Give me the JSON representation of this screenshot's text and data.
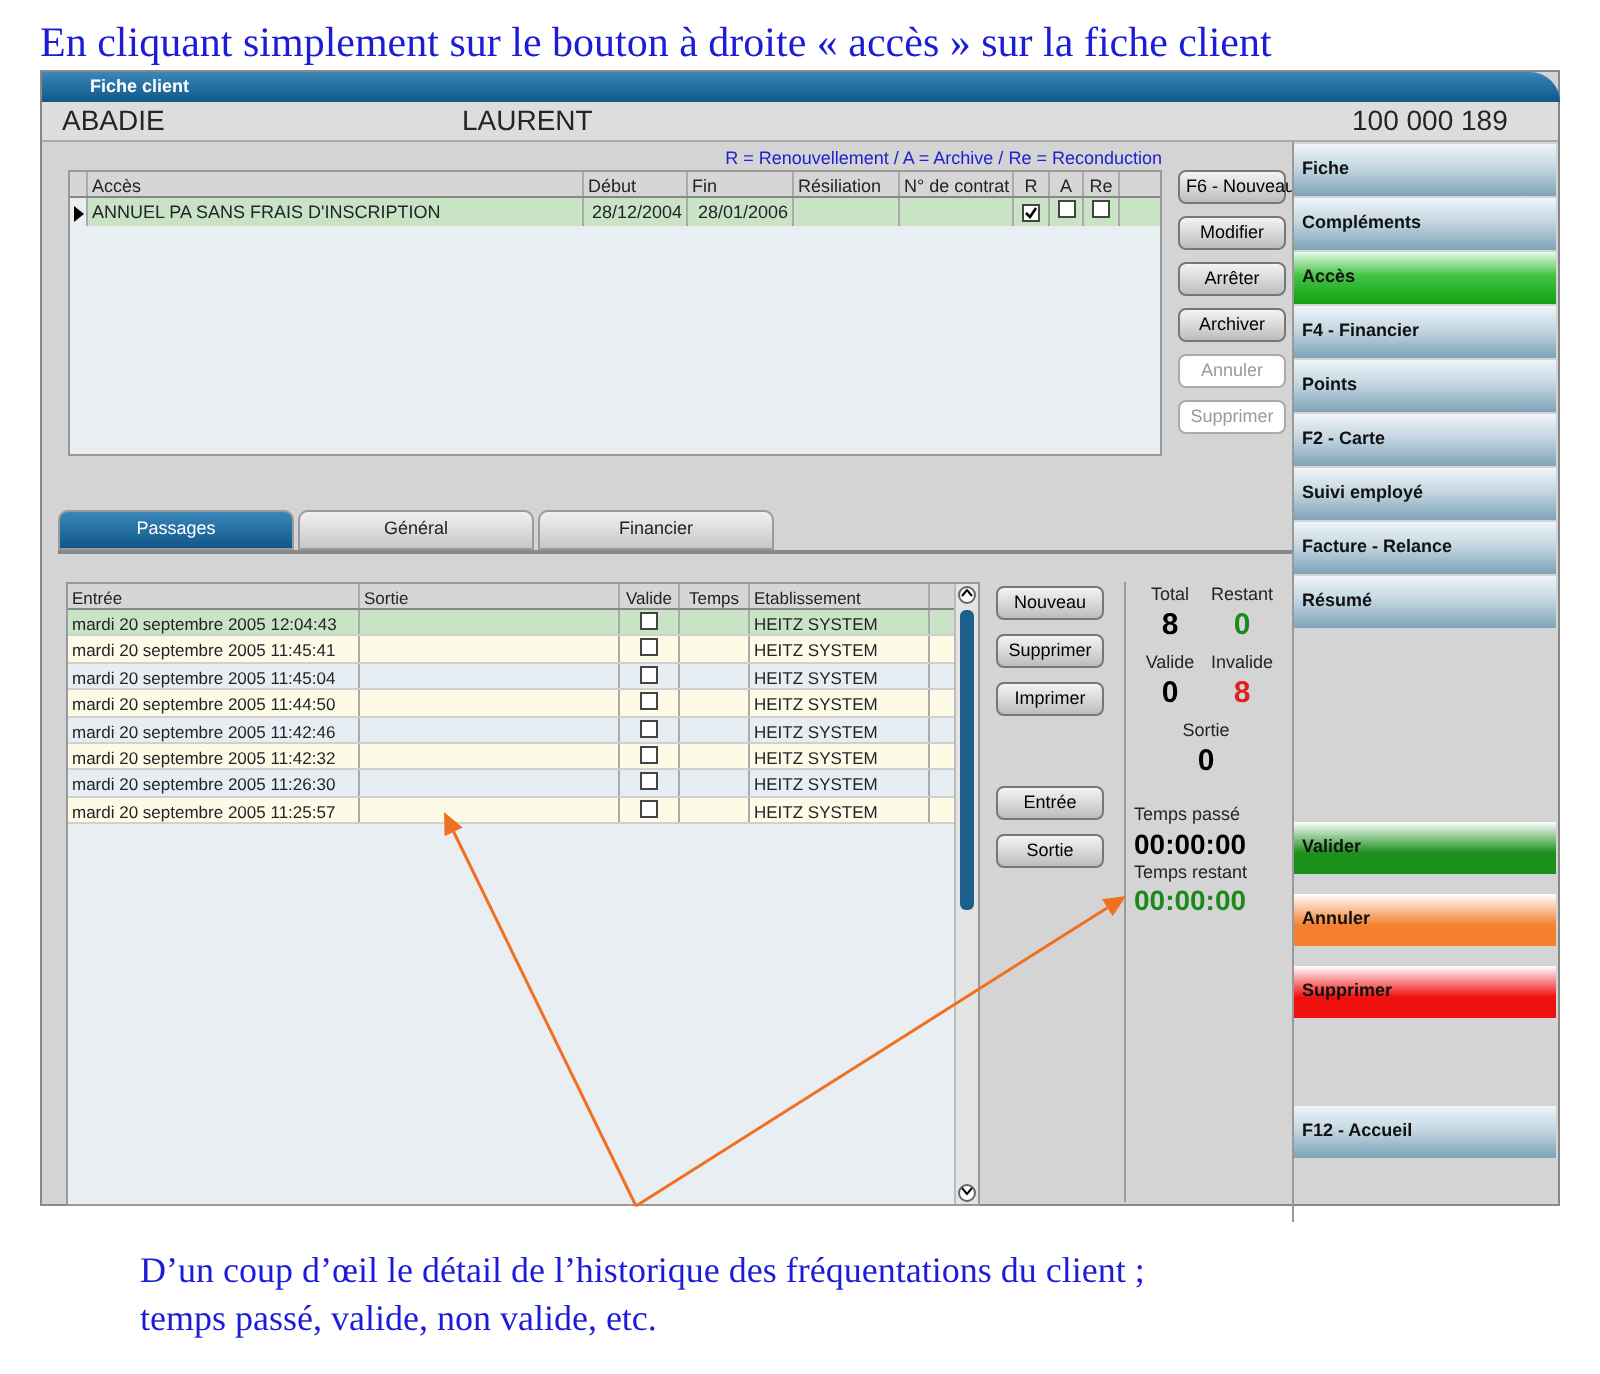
{
  "caption_top": "En cliquant simplement sur le bouton à droite « accès » sur la fiche client",
  "window": {
    "title": "Fiche client"
  },
  "client": {
    "last_name": "ABADIE",
    "first_name": "LAURENT",
    "number": "100 000 189"
  },
  "access": {
    "legend": "R = Renouvellement / A = Archive / Re = Reconduction",
    "columns": [
      "Accès",
      "Début",
      "Fin",
      "Résiliation",
      "N° de contrat",
      "R",
      "A",
      "Re"
    ],
    "rows": [
      {
        "current": true,
        "name": "ANNUEL PA SANS FRAIS D'INSCRIPTION",
        "start": "28/12/2004",
        "end": "28/01/2006",
        "r": true,
        "a": false,
        "re": false
      }
    ],
    "buttons": [
      {
        "label": "F6 - Nouveau",
        "disabled": false
      },
      {
        "label": "Modifier",
        "disabled": false
      },
      {
        "label": "Arrêter",
        "disabled": false
      },
      {
        "label": "Archiver",
        "disabled": false
      },
      {
        "label": "Annuler",
        "disabled": true
      },
      {
        "label": "Supprimer",
        "disabled": true
      }
    ]
  },
  "tabs": [
    {
      "label": "Passages",
      "selected": true
    },
    {
      "label": "Général",
      "selected": false
    },
    {
      "label": "Financier",
      "selected": false
    }
  ],
  "passages": {
    "columns": [
      "Entrée",
      "Sortie",
      "Valide",
      "Temps",
      "Etablissement"
    ],
    "rows": [
      {
        "entry": "mardi 20 septembre 2005 12:04:43",
        "valid": false,
        "site": "HEITZ SYSTEM",
        "selected": true
      },
      {
        "entry": "mardi 20 septembre 2005 11:45:41",
        "valid": false,
        "site": "HEITZ SYSTEM",
        "selected": false
      },
      {
        "entry": "mardi 20 septembre 2005 11:45:04",
        "valid": false,
        "site": "HEITZ SYSTEM",
        "selected": false
      },
      {
        "entry": "mardi 20 septembre 2005 11:44:50",
        "valid": false,
        "site": "HEITZ SYSTEM",
        "selected": false
      },
      {
        "entry": "mardi 20 septembre 2005 11:42:46",
        "valid": false,
        "site": "HEITZ SYSTEM",
        "selected": false
      },
      {
        "entry": "mardi 20 septembre 2005 11:42:32",
        "valid": false,
        "site": "HEITZ SYSTEM",
        "selected": false
      },
      {
        "entry": "mardi 20 septembre 2005 11:26:30",
        "valid": false,
        "site": "HEITZ SYSTEM",
        "selected": false
      },
      {
        "entry": "mardi 20 septembre 2005 11:25:57",
        "valid": false,
        "site": "HEITZ SYSTEM",
        "selected": false
      }
    ],
    "buttons_top": [
      "Nouveau",
      "Supprimer",
      "Imprimer"
    ],
    "buttons_bottom": [
      "Entrée",
      "Sortie"
    ]
  },
  "stats": {
    "counts": [
      {
        "label": "Total",
        "value": "8",
        "color": "#000000"
      },
      {
        "label": "Restant",
        "value": "0",
        "color": "#1a8a1a"
      },
      {
        "label": "Valide",
        "value": "0",
        "color": "#000000"
      },
      {
        "label": "Invalide",
        "value": "8",
        "color": "#e02020"
      },
      {
        "label": "Sortie",
        "value": "0",
        "color": "#000000"
      }
    ],
    "times": [
      {
        "label": "Temps passé",
        "value": "00:00:00",
        "color": "#000000"
      },
      {
        "label": "Temps restant",
        "value": "00:00:00",
        "color": "#1a8a1a"
      }
    ]
  },
  "sidebar": {
    "items": [
      {
        "label": "Fiche",
        "selected": false
      },
      {
        "label": "Compléments",
        "selected": false
      },
      {
        "label": "Accès",
        "selected": true
      },
      {
        "label": "F4 - Financier",
        "selected": false
      },
      {
        "label": "Points",
        "selected": false
      },
      {
        "label": "F2 - Carte",
        "selected": false
      },
      {
        "label": "Suivi employé",
        "selected": false
      },
      {
        "label": "Facture - Relance",
        "selected": false
      },
      {
        "label": "Résumé",
        "selected": false
      }
    ],
    "actions": [
      {
        "label": "Valider",
        "color": "#1a8f1a"
      },
      {
        "label": "Annuler",
        "color": "#f58030"
      },
      {
        "label": "Supprimer",
        "color": "#f01010"
      }
    ],
    "home": {
      "label": "F12 - Accueil"
    }
  },
  "caption_bottom": "D’un coup d’œil le détail de l’historique des fréquentations du client ; temps passé, valide, non valide, etc."
}
